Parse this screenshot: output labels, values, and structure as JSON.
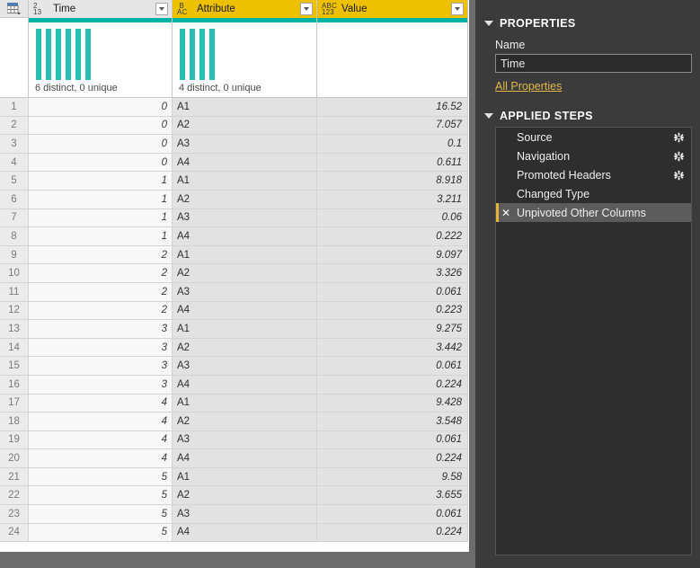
{
  "grid": {
    "corner_icon": "table-icon",
    "columns": [
      {
        "name": "Time",
        "type_icon": "number-type-icon",
        "type_top": "1",
        "type_sup": "2",
        "type_sub": "3",
        "selected": false,
        "quality": "6 distinct, 0 unique",
        "distinct_bars": 6
      },
      {
        "name": "Attribute",
        "type_icon": "text-type-icon",
        "type_top": "A",
        "type_sup": "B",
        "type_sub": "C",
        "selected": true,
        "quality": "4 distinct, 0 unique",
        "distinct_bars": 4
      },
      {
        "name": "Value",
        "type_icon": "any-type-icon",
        "type_top": "ABC",
        "type_sup": "",
        "type_sub": "123",
        "selected": true,
        "quality": "",
        "distinct_bars": 0
      }
    ],
    "rows": [
      {
        "n": "1",
        "time": "0",
        "attribute": "A1",
        "value": "16.52"
      },
      {
        "n": "2",
        "time": "0",
        "attribute": "A2",
        "value": "7.057"
      },
      {
        "n": "3",
        "time": "0",
        "attribute": "A3",
        "value": "0.1"
      },
      {
        "n": "4",
        "time": "0",
        "attribute": "A4",
        "value": "0.611"
      },
      {
        "n": "5",
        "time": "1",
        "attribute": "A1",
        "value": "8.918"
      },
      {
        "n": "6",
        "time": "1",
        "attribute": "A2",
        "value": "3.211"
      },
      {
        "n": "7",
        "time": "1",
        "attribute": "A3",
        "value": "0.06"
      },
      {
        "n": "8",
        "time": "1",
        "attribute": "A4",
        "value": "0.222"
      },
      {
        "n": "9",
        "time": "2",
        "attribute": "A1",
        "value": "9.097"
      },
      {
        "n": "10",
        "time": "2",
        "attribute": "A2",
        "value": "3.326"
      },
      {
        "n": "11",
        "time": "2",
        "attribute": "A3",
        "value": "0.061"
      },
      {
        "n": "12",
        "time": "2",
        "attribute": "A4",
        "value": "0.223"
      },
      {
        "n": "13",
        "time": "3",
        "attribute": "A1",
        "value": "9.275"
      },
      {
        "n": "14",
        "time": "3",
        "attribute": "A2",
        "value": "3.442"
      },
      {
        "n": "15",
        "time": "3",
        "attribute": "A3",
        "value": "0.061"
      },
      {
        "n": "16",
        "time": "3",
        "attribute": "A4",
        "value": "0.224"
      },
      {
        "n": "17",
        "time": "4",
        "attribute": "A1",
        "value": "9.428"
      },
      {
        "n": "18",
        "time": "4",
        "attribute": "A2",
        "value": "3.548"
      },
      {
        "n": "19",
        "time": "4",
        "attribute": "A3",
        "value": "0.061"
      },
      {
        "n": "20",
        "time": "4",
        "attribute": "A4",
        "value": "0.224"
      },
      {
        "n": "21",
        "time": "5",
        "attribute": "A1",
        "value": "9.58"
      },
      {
        "n": "22",
        "time": "5",
        "attribute": "A2",
        "value": "3.655"
      },
      {
        "n": "23",
        "time": "5",
        "attribute": "A3",
        "value": "0.061"
      },
      {
        "n": "24",
        "time": "5",
        "attribute": "A4",
        "value": "0.224"
      }
    ]
  },
  "side": {
    "properties_title": "PROPERTIES",
    "name_label": "Name",
    "name_value": "Time",
    "all_properties_link": "All Properties",
    "applied_steps_title": "APPLIED STEPS",
    "steps": [
      {
        "label": "Source",
        "gear": true,
        "active": false
      },
      {
        "label": "Navigation",
        "gear": true,
        "active": false
      },
      {
        "label": "Promoted Headers",
        "gear": true,
        "active": false
      },
      {
        "label": "Changed Type",
        "gear": false,
        "active": false
      },
      {
        "label": "Unpivoted Other Columns",
        "gear": false,
        "active": true
      }
    ]
  },
  "colors": {
    "selected_header": "#edc000",
    "quality_bar": "#28bfb0",
    "link": "#e3b94a",
    "panel_bg": "#3b3b3b",
    "active_step": "#5c5c5c",
    "active_step_marker": "#e8b33a"
  }
}
